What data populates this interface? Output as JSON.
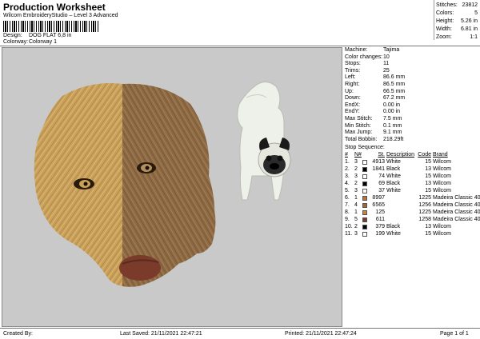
{
  "header": {
    "title": "Production Worksheet",
    "subtitle": "Wilcom EmbroideryStudio – Level 3 Advanced",
    "design_label": "Design:",
    "design_value": "DOG FLAT 6,8 in",
    "colorway_label": "Colorway:",
    "colorway_value": "Colorway 1"
  },
  "stats": [
    {
      "label": "Stitches:",
      "value": "23812"
    },
    {
      "label": "Colors:",
      "value": "5"
    },
    {
      "label": "Height:",
      "value": "5.26 in"
    },
    {
      "label": "Width:",
      "value": "6.81 in"
    },
    {
      "label": "Zoom:",
      "value": "1:1"
    }
  ],
  "machine_info": [
    {
      "label": "Machine:",
      "value": "Tajima"
    },
    {
      "label": "Color changes:",
      "value": "10"
    },
    {
      "label": "Stops:",
      "value": "11"
    },
    {
      "label": "Trims:",
      "value": "25"
    },
    {
      "label": "Left:",
      "value": "86.6 mm"
    },
    {
      "label": "Right:",
      "value": "86.5 mm"
    },
    {
      "label": "Up:",
      "value": "66.5 mm"
    },
    {
      "label": "Down:",
      "value": "67.2 mm"
    },
    {
      "label": "EndX:",
      "value": "0.00 in"
    },
    {
      "label": "EndY:",
      "value": "0.00 in"
    },
    {
      "label": "Max Stitch:",
      "value": "7.5 mm"
    },
    {
      "label": "Min Stitch:",
      "value": "0.1 mm"
    },
    {
      "label": "Max Jump:",
      "value": "9.1 mm"
    },
    {
      "label": "Total Bobbin:",
      "value": "218.29ft"
    }
  ],
  "stop_sequence": {
    "title": "Stop Sequence:",
    "headers": {
      "stop": "#",
      "num": "N#",
      "st": "St.",
      "desc": "Description",
      "code": "Code",
      "brand": "Brand"
    },
    "rows": [
      {
        "stop": "1.",
        "num": "3",
        "color": "#ffffff",
        "st": "4913",
        "desc": "White",
        "code": "15",
        "brand": "Wilcom"
      },
      {
        "stop": "2.",
        "num": "2",
        "color": "#000000",
        "st": "1841",
        "desc": "Black",
        "code": "13",
        "brand": "Wilcom"
      },
      {
        "stop": "3.",
        "num": "3",
        "color": "#ffffff",
        "st": "74",
        "desc": "White",
        "code": "15",
        "brand": "Wilcom"
      },
      {
        "stop": "4.",
        "num": "2",
        "color": "#000000",
        "st": "69",
        "desc": "Black",
        "code": "13",
        "brand": "Wilcom"
      },
      {
        "stop": "5.",
        "num": "3",
        "color": "#ffffff",
        "st": "37",
        "desc": "White",
        "code": "15",
        "brand": "Wilcom"
      },
      {
        "stop": "6.",
        "num": "1",
        "color": "#b5733a",
        "st": "8997",
        "desc": "",
        "code": "1225",
        "brand": "Madeira Classic 40"
      },
      {
        "stop": "7.",
        "num": "4",
        "color": "#9b6a3a",
        "st": "6565",
        "desc": "",
        "code": "1256",
        "brand": "Madeira Classic 40"
      },
      {
        "stop": "8.",
        "num": "1",
        "color": "#c8843e",
        "st": "125",
        "desc": "",
        "code": "1225",
        "brand": "Madeira Classic 40"
      },
      {
        "stop": "9.",
        "num": "5",
        "color": "#7a3b2a",
        "st": "611",
        "desc": "",
        "code": "1258",
        "brand": "Madeira Classic 40"
      },
      {
        "stop": "10.",
        "num": "2",
        "color": "#000000",
        "st": "379",
        "desc": "Black",
        "code": "13",
        "brand": "Wilcom"
      },
      {
        "stop": "11.",
        "num": "3",
        "color": "#ffffff",
        "st": "199",
        "desc": "White",
        "code": "15",
        "brand": "Wilcom"
      }
    ]
  },
  "footer": {
    "created_by": "Created By:",
    "last_saved": "Last Saved: 21/11/2021 22:47:21",
    "printed": "Printed: 21/11/2021 22:47:24",
    "page": "Page 1 of 1"
  },
  "colors": {
    "canvas_bg": "#c9c9c9",
    "golden_fur": "#c9a05a",
    "brown_fur": "#8e6a44",
    "nose": "#7a3b2a"
  }
}
